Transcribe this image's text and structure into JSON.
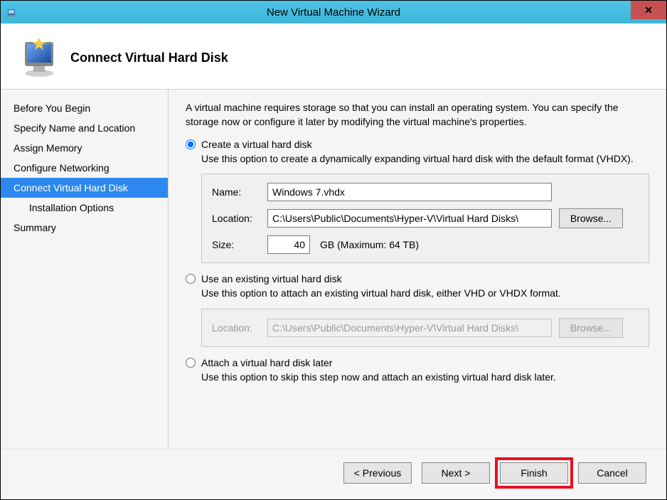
{
  "window": {
    "title": "New Virtual Machine Wizard"
  },
  "header": {
    "title": "Connect Virtual Hard Disk"
  },
  "sidebar": {
    "items": [
      {
        "label": "Before You Begin",
        "selected": false,
        "indented": false
      },
      {
        "label": "Specify Name and Location",
        "selected": false,
        "indented": false
      },
      {
        "label": "Assign Memory",
        "selected": false,
        "indented": false
      },
      {
        "label": "Configure Networking",
        "selected": false,
        "indented": false
      },
      {
        "label": "Connect Virtual Hard Disk",
        "selected": true,
        "indented": false
      },
      {
        "label": "Installation Options",
        "selected": false,
        "indented": true
      },
      {
        "label": "Summary",
        "selected": false,
        "indented": false
      }
    ]
  },
  "content": {
    "intro": "A virtual machine requires storage so that you can install an operating system. You can specify the storage now or configure it later by modifying the virtual machine's properties.",
    "option1": {
      "label": "Create a virtual hard disk",
      "desc": "Use this option to create a dynamically expanding virtual hard disk with the default format (VHDX).",
      "name_label": "Name:",
      "name_value": "Windows 7.vhdx",
      "location_label": "Location:",
      "location_value": "C:\\Users\\Public\\Documents\\Hyper-V\\Virtual Hard Disks\\",
      "browse_label": "Browse...",
      "size_label": "Size:",
      "size_value": "40",
      "size_suffix": "GB (Maximum: 64 TB)"
    },
    "option2": {
      "label": "Use an existing virtual hard disk",
      "desc": "Use this option to attach an existing virtual hard disk, either VHD or VHDX format.",
      "location_label": "Location:",
      "location_value": "C:\\Users\\Public\\Documents\\Hyper-V\\Virtual Hard Disks\\",
      "browse_label": "Browse..."
    },
    "option3": {
      "label": "Attach a virtual hard disk later",
      "desc": "Use this option to skip this step now and attach an existing virtual hard disk later."
    }
  },
  "footer": {
    "previous": "< Previous",
    "next": "Next >",
    "finish": "Finish",
    "cancel": "Cancel"
  }
}
